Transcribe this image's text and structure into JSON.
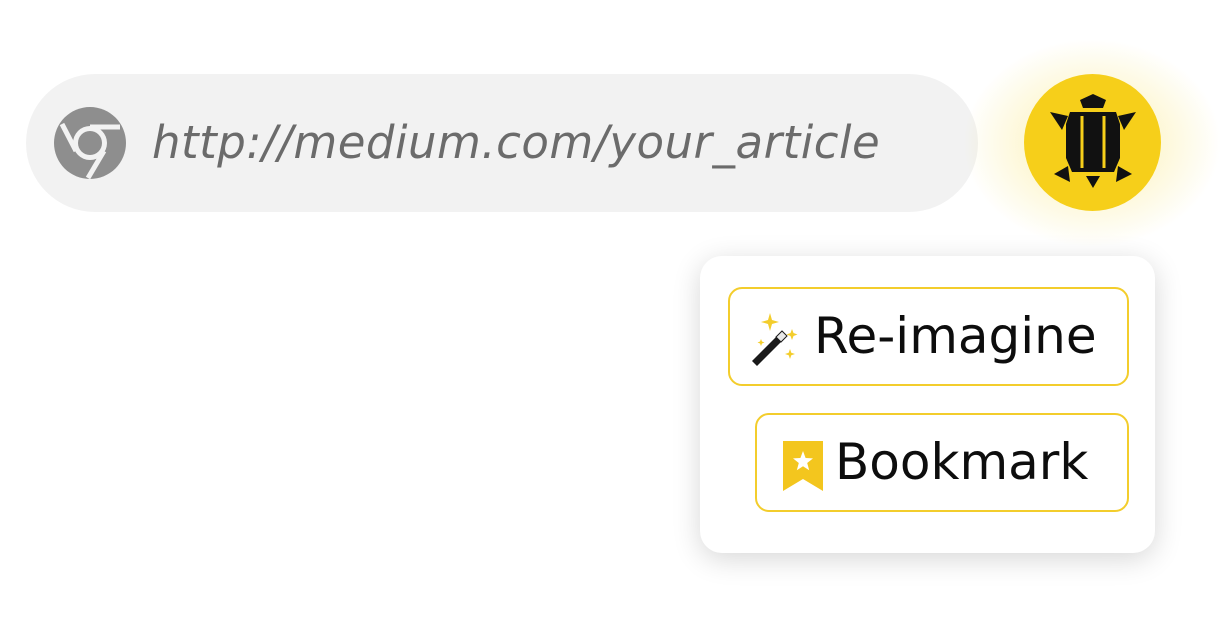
{
  "address_bar": {
    "url": "http://medium.com/your_article",
    "browser_icon": "chrome-logo-icon"
  },
  "extension": {
    "icon": "turtle-icon",
    "color": "#f6cf1a"
  },
  "popup": {
    "items": [
      {
        "label": "Re-imagine",
        "icon": "magic-wand-icon"
      },
      {
        "label": "Bookmark",
        "icon": "bookmark-star-icon"
      }
    ],
    "border_color": "#f3cd2c"
  }
}
